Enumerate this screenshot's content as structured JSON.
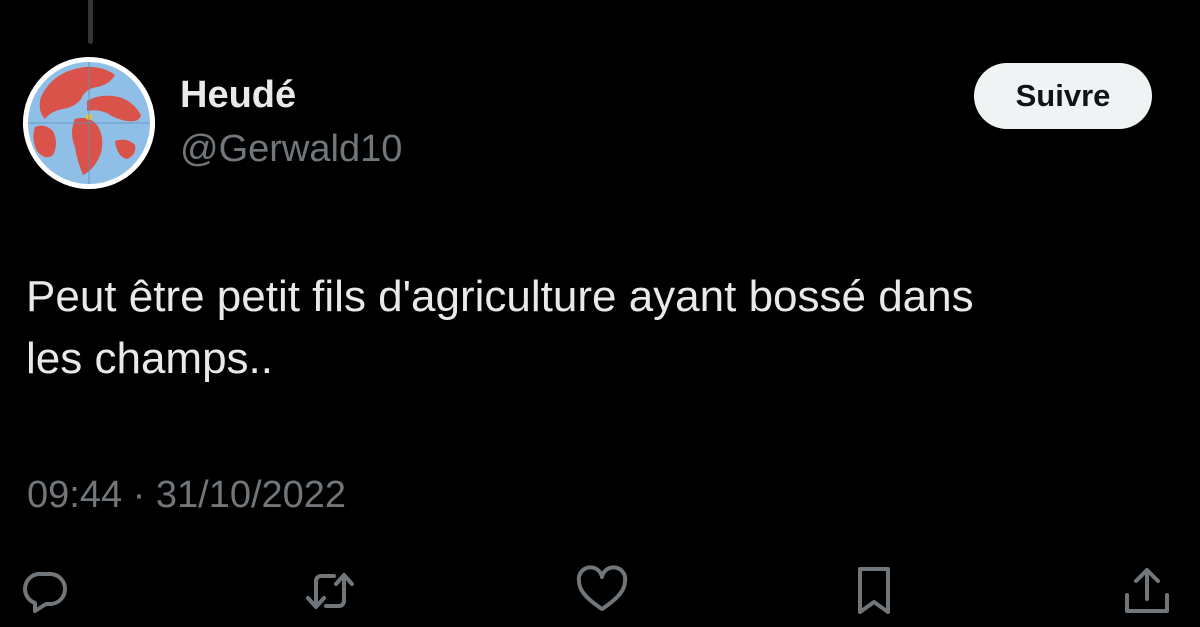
{
  "tweet": {
    "author": {
      "display_name": "Heudé",
      "handle": "@Gerwald10",
      "avatar": "world-map-avatar"
    },
    "follow_label": "Suivre",
    "text_line1": "Peut être petit fils d'agriculture ayant bossé dans",
    "text_line2": "les champs..",
    "timestamp": "09:44 · 31/10/2022"
  },
  "actions": [
    {
      "name": "reply",
      "icon": "reply-icon"
    },
    {
      "name": "retweet",
      "icon": "retweet-icon"
    },
    {
      "name": "like",
      "icon": "heart-icon"
    },
    {
      "name": "bookmark",
      "icon": "bookmark-icon"
    },
    {
      "name": "share",
      "icon": "share-icon"
    }
  ],
  "colors": {
    "background": "#000000",
    "primary_text": "#e7e9ea",
    "secondary_text": "#71767b",
    "follow_button_bg": "#eff3f4",
    "follow_button_text": "#0f1419"
  }
}
